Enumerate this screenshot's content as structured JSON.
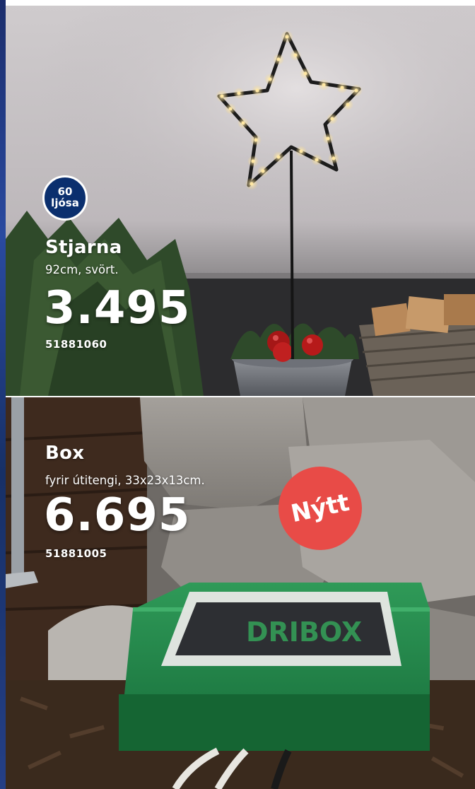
{
  "products": [
    {
      "badge_number": "60",
      "badge_word": "ljósa",
      "name": "Stjarna",
      "description": "92cm, svört.",
      "price": "3.495",
      "sku": "51881060"
    },
    {
      "badge": "Nýtt",
      "name": "Box",
      "description": "fyrir útitengi, 33x23x13cm.",
      "price": "6.695",
      "sku": "51881005",
      "product_print": "DRIBOX"
    }
  ]
}
